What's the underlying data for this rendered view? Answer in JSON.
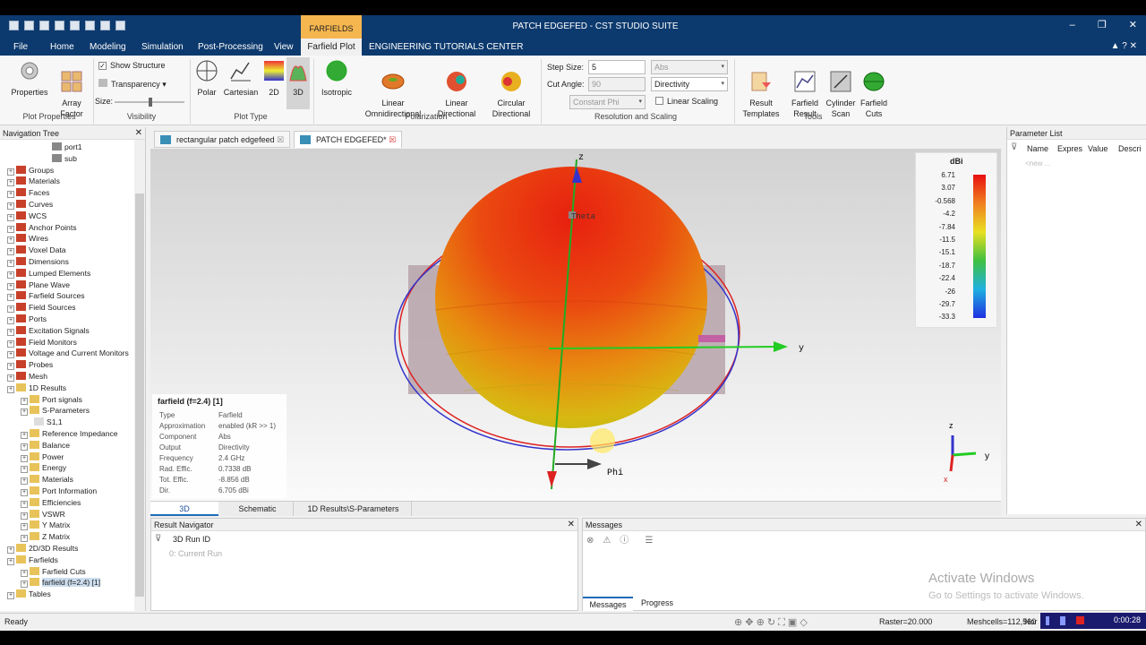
{
  "window": {
    "title": "PATCH EDGEFED - CST STUDIO SUITE"
  },
  "ribbon_tabs": [
    "File",
    "Home",
    "Modeling",
    "Simulation",
    "Post-Processing",
    "View",
    "Farfield Plot",
    "ENGINEERING TUTORIALS CENTER"
  ],
  "context_tab": {
    "header": "FARFIELDS",
    "label": "Farfield Plot"
  },
  "ribbon": {
    "plot_properties": {
      "properties": "Properties",
      "array_factor": "Array\nFactor",
      "group": "Plot Properties"
    },
    "visibility": {
      "show_structure": "Show Structure",
      "transparency": "Transparency",
      "size": "Size:",
      "group": "Visibility"
    },
    "plot_type": {
      "polar": "Polar",
      "cartesian": "Cartesian",
      "d2": "2D",
      "d3": "3D",
      "group": "Plot Type"
    },
    "polarization": {
      "isotropic": "Isotropic",
      "linear_omni": "Linear\nOmnidirectional",
      "linear_dir": "Linear\nDirectional",
      "circular_dir": "Circular\nDirectional",
      "group": "Polarization"
    },
    "resolution": {
      "step_size_label": "Step Size:",
      "step_size": "5",
      "cut_angle_label": "Cut Angle:",
      "cut_angle": "90",
      "constant": "Constant Phi",
      "abs": "Abs",
      "directivity": "Directivity",
      "linear_scaling": "Linear Scaling",
      "group": "Resolution and Scaling"
    },
    "tools": {
      "result_templates": "Result\nTemplates",
      "farfield_result": "Farfield\nResult",
      "cylinder_scan": "Cylinder\nScan",
      "farfield_cuts": "Farfield\nCuts",
      "group": "Tools"
    }
  },
  "nav_tree": {
    "title": "Navigation Tree",
    "items": [
      {
        "label": "port1",
        "indent": 4
      },
      {
        "label": "sub",
        "indent": 4
      },
      {
        "label": "Groups",
        "indent": 0
      },
      {
        "label": "Materials",
        "indent": 0
      },
      {
        "label": "Faces",
        "indent": 0
      },
      {
        "label": "Curves",
        "indent": 0
      },
      {
        "label": "WCS",
        "indent": 0
      },
      {
        "label": "Anchor Points",
        "indent": 0
      },
      {
        "label": "Wires",
        "indent": 0
      },
      {
        "label": "Voxel Data",
        "indent": 0
      },
      {
        "label": "Dimensions",
        "indent": 0
      },
      {
        "label": "Lumped Elements",
        "indent": 0
      },
      {
        "label": "Plane Wave",
        "indent": 0
      },
      {
        "label": "Farfield Sources",
        "indent": 0
      },
      {
        "label": "Field Sources",
        "indent": 0
      },
      {
        "label": "Ports",
        "indent": 0
      },
      {
        "label": "Excitation Signals",
        "indent": 0
      },
      {
        "label": "Field Monitors",
        "indent": 0
      },
      {
        "label": "Voltage and Current Monitors",
        "indent": 0
      },
      {
        "label": "Probes",
        "indent": 0
      },
      {
        "label": "Mesh",
        "indent": 0
      },
      {
        "label": "1D Results",
        "indent": 0
      },
      {
        "label": "Port signals",
        "indent": 1
      },
      {
        "label": "S-Parameters",
        "indent": 1
      },
      {
        "label": "S1,1",
        "indent": 2
      },
      {
        "label": "Reference Impedance",
        "indent": 1
      },
      {
        "label": "Balance",
        "indent": 1
      },
      {
        "label": "Power",
        "indent": 1
      },
      {
        "label": "Energy",
        "indent": 1
      },
      {
        "label": "Materials",
        "indent": 1
      },
      {
        "label": "Port Information",
        "indent": 1
      },
      {
        "label": "Efficiencies",
        "indent": 1
      },
      {
        "label": "VSWR",
        "indent": 1
      },
      {
        "label": "Y Matrix",
        "indent": 1
      },
      {
        "label": "Z Matrix",
        "indent": 1
      },
      {
        "label": "2D/3D Results",
        "indent": 0
      },
      {
        "label": "Farfields",
        "indent": 0
      },
      {
        "label": "Farfield Cuts",
        "indent": 1
      },
      {
        "label": "farfield (f=2.4) [1]",
        "indent": 1
      },
      {
        "label": "Tables",
        "indent": 0
      }
    ]
  },
  "doc_tabs": [
    "rectangular patch edgefeed",
    "PATCH EDGEFED*"
  ],
  "viewport": {
    "axis_z": "z",
    "axis_y": "y",
    "axis_x": "x",
    "theta": "Theta",
    "phi": "Phi",
    "info": {
      "title": "farfield (f=2.4) [1]",
      "rows": [
        {
          "k": "Type",
          "v": "Farfield"
        },
        {
          "k": "Approximation",
          "v": "enabled (kR >> 1)"
        },
        {
          "k": "Component",
          "v": "Abs"
        },
        {
          "k": "Output",
          "v": "Directivity"
        },
        {
          "k": "Frequency",
          "v": "2.4 GHz"
        },
        {
          "k": "Rad. Effic.",
          "v": "0.7338 dB"
        },
        {
          "k": "Tot. Effic.",
          "v": "-8.856 dB"
        },
        {
          "k": "Dir.",
          "v": "6.705 dBi"
        }
      ]
    },
    "legend": {
      "unit": "dBi",
      "ticks": [
        "6.71",
        "3.07",
        "-0.568",
        "-4.2",
        "-7.84",
        "-11.5",
        "-15.1",
        "-18.7",
        "-22.4",
        "-26",
        "-29.7",
        "-33.3"
      ]
    }
  },
  "view_tabs": [
    "3D",
    "Schematic",
    "1D Results\\S-Parameters"
  ],
  "result_navigator": {
    "title": "Result Navigator",
    "col": "3D Run ID",
    "row": "0: Current Run"
  },
  "messages": {
    "title": "Messages",
    "tabs": [
      "Messages",
      "Progress"
    ],
    "watermark1": "Activate Windows",
    "watermark2": "Go to Settings to activate Windows."
  },
  "parameter_list": {
    "title": "Parameter List",
    "cols": [
      "Name",
      "Expres",
      "Value",
      "Descri"
    ],
    "new": "<new ..."
  },
  "status": {
    "ready": "Ready",
    "raster": "Raster=20.000",
    "meshcells": "Meshcells=112,560",
    "nor": "Nor",
    "time": "0:00:28"
  }
}
